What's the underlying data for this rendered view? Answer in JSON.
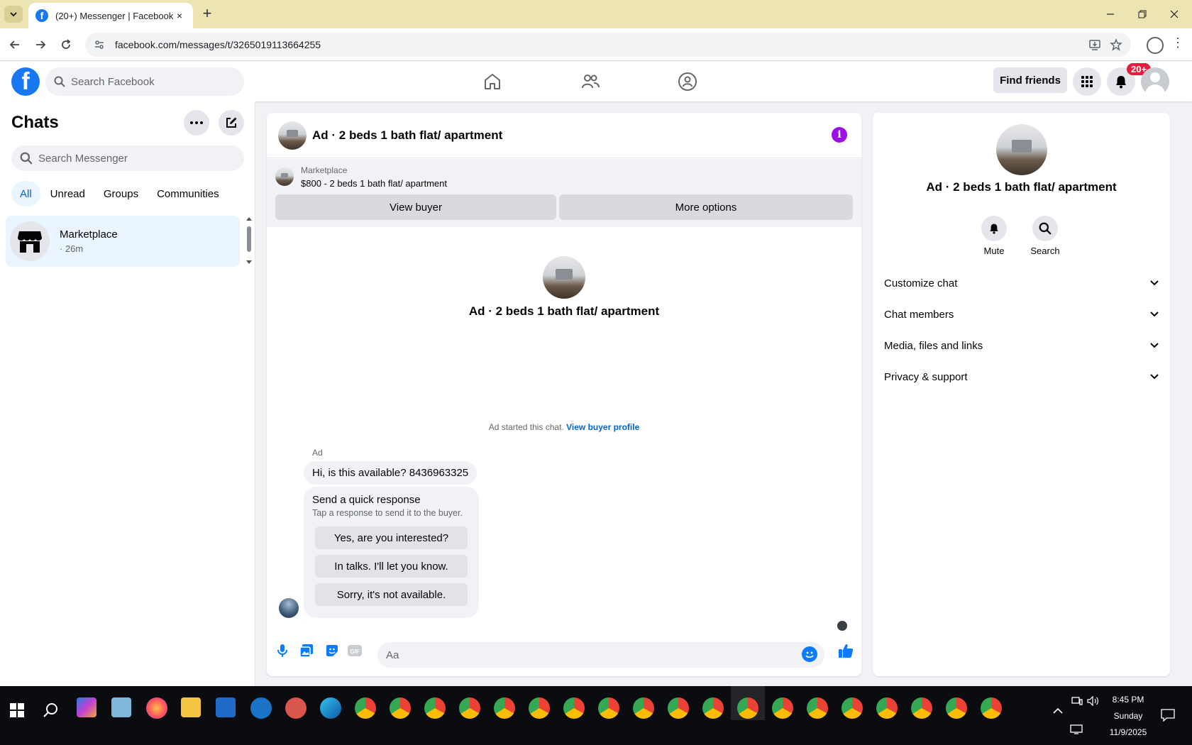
{
  "browser": {
    "tab_title": "(20+) Messenger | Facebook",
    "tab_close": "×",
    "new_tab": "+",
    "url": "facebook.com/messages/t/3265019113664255",
    "window_controls": [
      "—",
      "❐",
      "✕"
    ]
  },
  "facebook": {
    "search_placeholder": "Search Facebook",
    "find_friends": "Find friends",
    "notification_badge": "20+",
    "accent_color": "#1877f2"
  },
  "chats": {
    "title": "Chats",
    "search_placeholder": "Search Messenger",
    "filters": [
      "All",
      "Unread",
      "Groups",
      "Communities"
    ],
    "active_filter": "All",
    "items": [
      {
        "name": "Marketplace",
        "time": "· 26m"
      }
    ]
  },
  "conversation": {
    "title": "Ad · 2 beds 1 bath flat/ apartment",
    "marketplace_label": "Marketplace",
    "listing": "$800 - 2 beds 1 bath flat/ apartment",
    "view_buyer": "View buyer",
    "more_options": "More options",
    "center_title": "Ad · 2 beds 1 bath flat/ apartment",
    "started_text": "Ad started this chat.",
    "view_buyer_profile": "View buyer profile",
    "sender": "Ad",
    "message": "Hi, is this available? 8436963325",
    "quick_response_title": "Send a quick response",
    "quick_response_sub": "Tap a response to send it to the buyer.",
    "quick_responses": [
      "Yes, are you interested?",
      "In talks. I'll let you know.",
      "Sorry, it's not available."
    ],
    "composer_placeholder": "Aa"
  },
  "info_panel": {
    "title": "Ad · 2 beds 1 bath flat/ apartment",
    "mute": "Mute",
    "search": "Search",
    "sections": [
      "Customize chat",
      "Chat members",
      "Media, files and links",
      "Privacy & support"
    ]
  },
  "taskbar": {
    "time": "8:45 PM",
    "day": "Sunday",
    "date": "11/9/2025"
  }
}
